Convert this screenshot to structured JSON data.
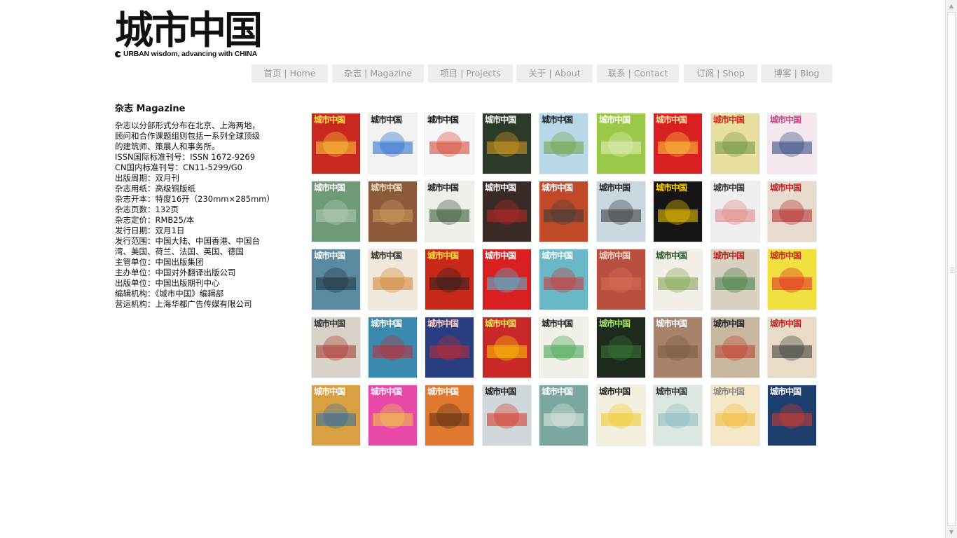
{
  "logo": {
    "title": "城市中国",
    "tagline": "URBAN wisdom, advancing with CHINA"
  },
  "nav": [
    {
      "label": "首页 | Home"
    },
    {
      "label": "杂志 | Magazine"
    },
    {
      "label": "项目 | Projects"
    },
    {
      "label": "关于 | About"
    },
    {
      "label": "联系 | Contact"
    },
    {
      "label": "订阅 | Shop"
    },
    {
      "label": "博客 | Blog"
    }
  ],
  "info": {
    "title": "杂志 Magazine",
    "text": "杂志以分部形式分布在北京、上海两地，\n顾问和合作课题组则包括一系列全球顶级\n的建筑师、策展人和事务所。\nISSN国际标准刊号：ISSN 1672-9269\nCN国内标准刊号：CN11-5299/G0\n出版周期：双月刊\n杂志用纸：高级铜版纸\n杂志开本：特度16开（230mm×285mm）\n杂志页数：132页\n杂志定价：RMB25/本\n发行日期：双月1日\n发行范围：中国大陆、中国香港、中国台\n湾、美国、荷兰、法国、英国、德国\n主管单位：中国出版集团\n主办单位：中国对外翻译出版公司\n出版单位：中国出版期刊中心\n编辑机构：《城市中国》编辑部\n营运机构：上海华都广告传媒有限公司"
  },
  "colors": {
    "nav_bg": "#eeeeee",
    "nav_text": "#9a9a9a"
  },
  "covers": [
    {
      "bg": "#c8281e",
      "fg": "#ffe14a",
      "accent": "#ffd23c"
    },
    {
      "bg": "#f2f2f2",
      "fg": "#222222",
      "accent": "#1e64c8"
    },
    {
      "bg": "#f7f7f7",
      "fg": "#111111",
      "accent": "#d23c28"
    },
    {
      "bg": "#2c3a2a",
      "fg": "#ffffff",
      "accent": "#e0a020"
    },
    {
      "bg": "#b8d8e8",
      "fg": "#222222",
      "accent": "#6aa040"
    },
    {
      "bg": "#9cc84a",
      "fg": "#ffffff",
      "accent": "#e8f0c0"
    },
    {
      "bg": "#d82020",
      "fg": "#ffe0a0",
      "accent": "#ffd040"
    },
    {
      "bg": "#e8e0a0",
      "fg": "#e02020",
      "accent": "#6a9040"
    },
    {
      "bg": "#f4e8f0",
      "fg": "#d04080",
      "accent": "#283e78"
    },
    {
      "bg": "#6e9a78",
      "fg": "#ffffff",
      "accent": "#b8d0b8"
    },
    {
      "bg": "#8a5a3a",
      "fg": "#f0e0c0",
      "accent": "#d0a060"
    },
    {
      "bg": "#eef0ea",
      "fg": "#222222",
      "accent": "#2a4a2a"
    },
    {
      "bg": "#3a2a26",
      "fg": "#ffffff",
      "accent": "#c02828"
    },
    {
      "bg": "#c04a28",
      "fg": "#ffffff",
      "accent": "#3a3a3a"
    },
    {
      "bg": "#cad8e0",
      "fg": "#222222",
      "accent": "#303030"
    },
    {
      "bg": "#151515",
      "fg": "#ffd000",
      "accent": "#ffd000"
    },
    {
      "bg": "#f0eeee",
      "fg": "#333333",
      "accent": "#e08080"
    },
    {
      "bg": "#e8dcd0",
      "fg": "#c02020",
      "accent": "#b02020"
    },
    {
      "bg": "#5a8aa0",
      "fg": "#ffffff",
      "accent": "#1e2e38"
    },
    {
      "bg": "#f0e8dc",
      "fg": "#333333",
      "accent": "#d08030"
    },
    {
      "bg": "#c82818",
      "fg": "#ffe040",
      "accent": "#202020"
    },
    {
      "bg": "#d82020",
      "fg": "#ffffff",
      "accent": "#4ac0e0"
    },
    {
      "bg": "#68b8c8",
      "fg": "#ffffff",
      "accent": "#d03030"
    },
    {
      "bg": "#b85040",
      "fg": "#f0d8c8",
      "accent": "#d87058"
    },
    {
      "bg": "#f2f0e8",
      "fg": "#2a5a2a",
      "accent": "#7aa048"
    },
    {
      "bg": "#d8d0c0",
      "fg": "#c02020",
      "accent": "#3a7a40"
    },
    {
      "bg": "#f0e040",
      "fg": "#d02020",
      "accent": "#e02020"
    },
    {
      "bg": "#d8d2c8",
      "fg": "#333333",
      "accent": "#a83028"
    },
    {
      "bg": "#3a8ab0",
      "fg": "#ffffff",
      "accent": "#c82830"
    },
    {
      "bg": "#283e80",
      "fg": "#ffd0d0",
      "accent": "#c82830"
    },
    {
      "bg": "#c82828",
      "fg": "#ffe060",
      "accent": "#ffd000"
    },
    {
      "bg": "#f2f0e8",
      "fg": "#222222",
      "accent": "#38a048"
    },
    {
      "bg": "#1e2a1e",
      "fg": "#a8e060",
      "accent": "#3a7a3a"
    },
    {
      "bg": "#a8826a",
      "fg": "#ffffff",
      "accent": "#7a5a40"
    },
    {
      "bg": "#c8b8a0",
      "fg": "#222222",
      "accent": "#c03828"
    },
    {
      "bg": "#e8dcc8",
      "fg": "#c02020",
      "accent": "#303030"
    },
    {
      "bg": "#d8a040",
      "fg": "#ffffff",
      "accent": "#2a6aa8"
    },
    {
      "bg": "#e848a8",
      "fg": "#ffffff",
      "accent": "#f0d040"
    },
    {
      "bg": "#e07830",
      "fg": "#ffffff",
      "accent": "#5a2a10"
    },
    {
      "bg": "#d0d8dc",
      "fg": "#222222",
      "accent": "#d83020"
    },
    {
      "bg": "#7aa8a0",
      "fg": "#ffffff",
      "accent": "#e8ece8"
    },
    {
      "bg": "#f4f0e0",
      "fg": "#222222",
      "accent": "#f0c820"
    },
    {
      "bg": "#dde8e0",
      "fg": "#333333",
      "accent": "#88b8c0"
    },
    {
      "bg": "#f4e8c8",
      "fg": "#888888",
      "accent": "#f0b830"
    },
    {
      "bg": "#1e3e6e",
      "fg": "#ffffff",
      "accent": "#d83a2a"
    }
  ]
}
